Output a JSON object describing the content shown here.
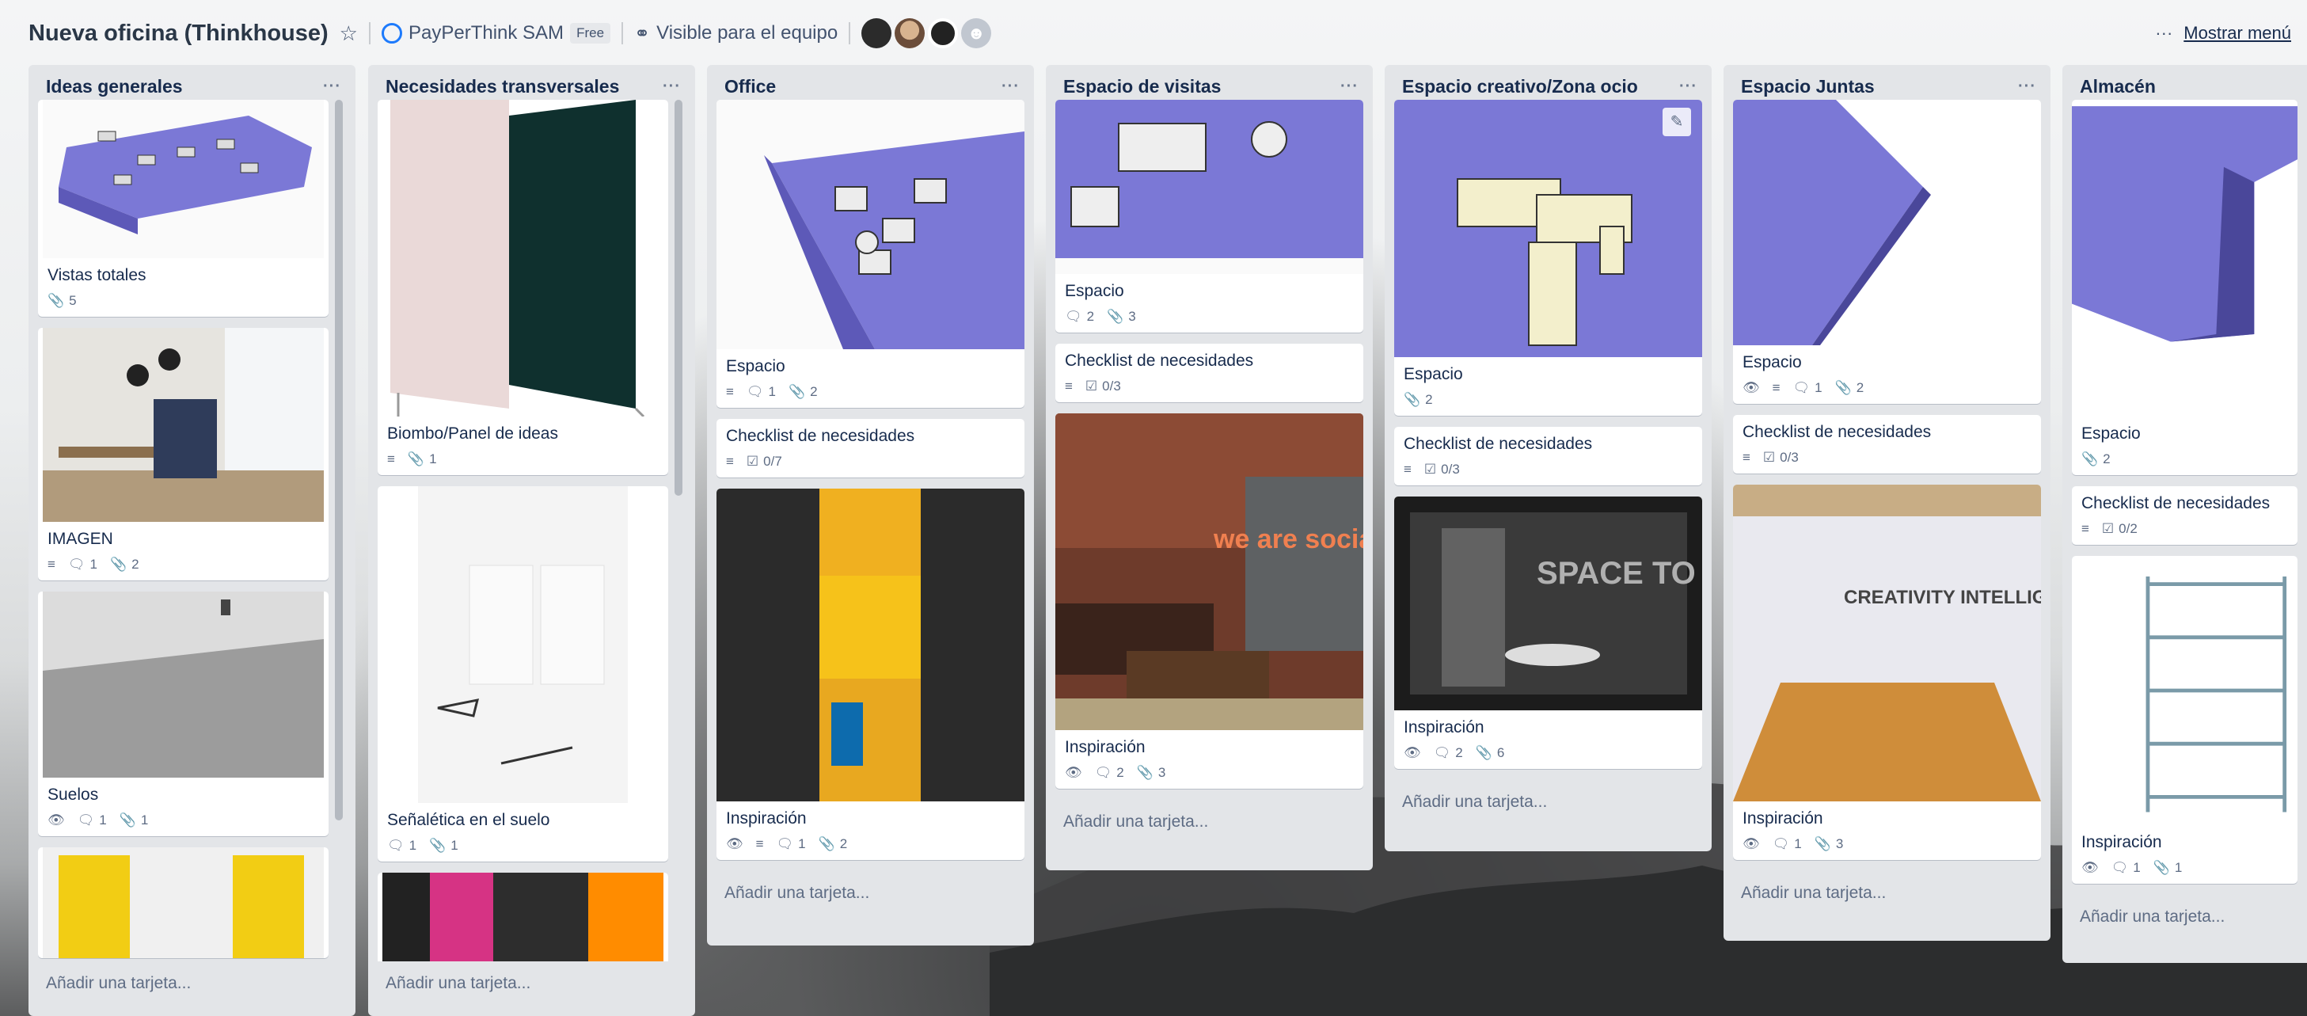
{
  "header": {
    "board_title": "Nueva oficina (Thinkhouse)",
    "team_name": "PayPerThink SAM",
    "team_plan": "Free",
    "visibility": "Visible para el equipo",
    "more_dots": "···",
    "show_menu": "Mostrar menú"
  },
  "lists": [
    {
      "title": "Ideas generales",
      "menu": "···",
      "add_card": "Añadir una tarjeta...",
      "cards": [
        {
          "title": "Vistas totales",
          "attachments": "5"
        },
        {
          "title": "IMAGEN",
          "comments": "1",
          "attachments": "2"
        },
        {
          "title": "Suelos",
          "comments": "1",
          "attachments": "1"
        }
      ]
    },
    {
      "title": "Necesidades transversales",
      "menu": "···",
      "add_card": "Añadir una tarjeta...",
      "cards": [
        {
          "title": "Biombo/Panel de ideas",
          "attachments": "1"
        },
        {
          "title": "Señalética en el suelo",
          "comments": "1",
          "attachments": "1"
        }
      ]
    },
    {
      "title": "Office",
      "menu": "···",
      "add_card": "Añadir una tarjeta...",
      "cards": [
        {
          "title": "Espacio",
          "comments": "1",
          "attachments": "2"
        },
        {
          "title": "Checklist de necesidades",
          "checklist": "0/7"
        },
        {
          "title": "Inspiración",
          "comments": "1",
          "attachments": "2"
        }
      ]
    },
    {
      "title": "Espacio de visitas",
      "menu": "···",
      "add_card": "Añadir una tarjeta...",
      "cards": [
        {
          "title": "Espacio",
          "comments": "2",
          "attachments": "3"
        },
        {
          "title": "Checklist de necesidades",
          "checklist": "0/3"
        },
        {
          "title": "Inspiración",
          "comments": "2",
          "attachments": "3",
          "sign_text": "we are social"
        }
      ]
    },
    {
      "title": "Espacio creativo/Zona ocio",
      "menu": "···",
      "add_card": "Añadir una tarjeta...",
      "cards": [
        {
          "title": "Espacio",
          "attachments": "2"
        },
        {
          "title": "Checklist de necesidades",
          "checklist": "0/3"
        },
        {
          "title": "Inspiración",
          "comments": "2",
          "attachments": "6",
          "sign_text": "SPACE TO CREATE"
        }
      ]
    },
    {
      "title": "Espacio Juntas",
      "menu": "···",
      "add_card": "Añadir una tarjeta...",
      "cards": [
        {
          "title": "Espacio",
          "comments": "1",
          "attachments": "2"
        },
        {
          "title": "Checklist de necesidades",
          "checklist": "0/3"
        },
        {
          "title": "Inspiración",
          "comments": "1",
          "attachments": "3",
          "sign_text": "CREATIVITY INTELLIGENCE HAVING FUN"
        }
      ]
    },
    {
      "title": "Almacén",
      "add_card": "Añadir una tarjeta...",
      "cards": [
        {
          "title": "Espacio",
          "attachments": "2"
        },
        {
          "title": "Checklist de necesidades",
          "checklist": "0/2"
        },
        {
          "title": "Inspiración",
          "comments": "1",
          "attachments": "1"
        }
      ]
    }
  ],
  "colors": {
    "plan_purple": "#7b78d6",
    "list_bg": "#e3e5e8",
    "card_bg": "#ffffff"
  }
}
